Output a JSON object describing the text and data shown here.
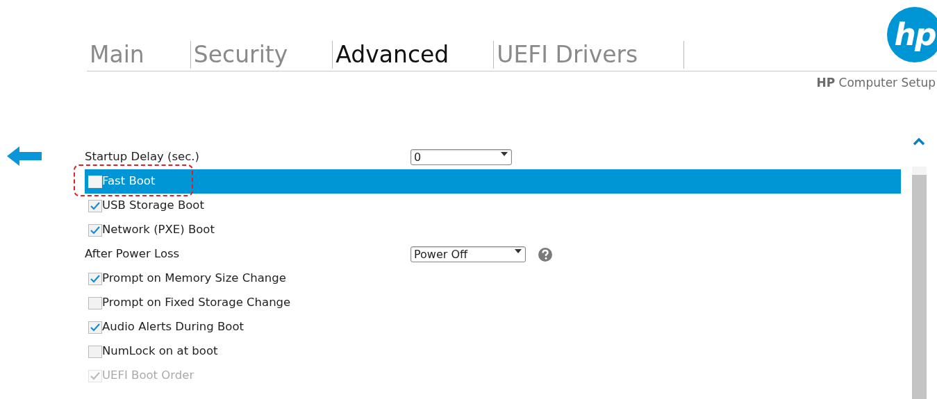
{
  "logo": {
    "text": "hp"
  },
  "tabs": [
    {
      "label": "Main",
      "selected": false
    },
    {
      "label": "Security",
      "selected": false
    },
    {
      "label": "Advanced",
      "selected": true
    },
    {
      "label": "UEFI Drivers",
      "selected": false
    }
  ],
  "subtitle": "**HP** Computer Setup",
  "settings": [
    {
      "kind": "select",
      "label": "Startup Delay (sec.)",
      "value": "0",
      "help": false,
      "selected": false
    },
    {
      "kind": "checkbox",
      "label": "Fast Boot",
      "checked": false,
      "disabled": false,
      "selected": true,
      "highlighted": true
    },
    {
      "kind": "checkbox",
      "label": "USB Storage Boot",
      "checked": true,
      "disabled": false,
      "selected": false,
      "highlighted": false
    },
    {
      "kind": "checkbox",
      "label": "Network (PXE) Boot",
      "checked": true,
      "disabled": false,
      "selected": false,
      "highlighted": false
    },
    {
      "kind": "select",
      "label": "After Power Loss",
      "value": "Power Off",
      "help": true,
      "selected": false
    },
    {
      "kind": "checkbox",
      "label": "Prompt on Memory Size Change",
      "checked": true,
      "disabled": false,
      "selected": false,
      "highlighted": false
    },
    {
      "kind": "checkbox",
      "label": "Prompt on Fixed Storage Change",
      "checked": false,
      "disabled": false,
      "selected": false,
      "highlighted": false
    },
    {
      "kind": "checkbox",
      "label": "Audio Alerts During Boot",
      "checked": true,
      "disabled": false,
      "selected": false,
      "highlighted": false
    },
    {
      "kind": "checkbox",
      "label": "NumLock on at boot",
      "checked": false,
      "disabled": false,
      "selected": false,
      "highlighted": false
    },
    {
      "kind": "checkbox",
      "label": "UEFI Boot Order",
      "checked": true,
      "disabled": true,
      "selected": false,
      "highlighted": false
    }
  ]
}
